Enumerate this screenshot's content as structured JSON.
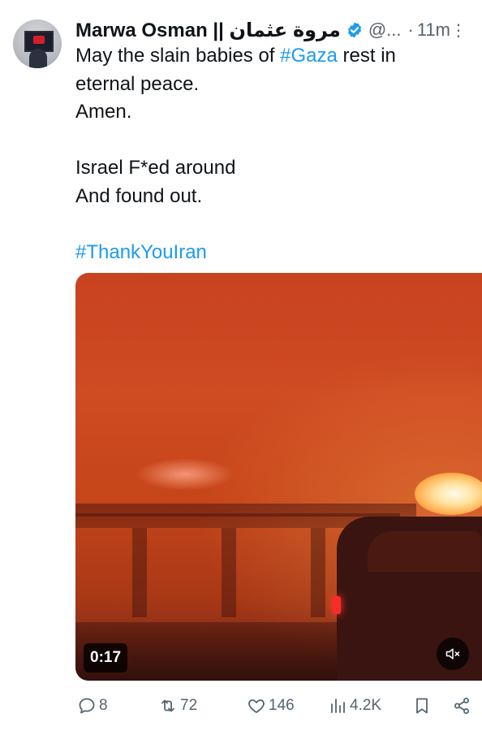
{
  "tweet": {
    "author_name": "Marwa Osman || مروة عثمان",
    "handle": "@...",
    "separator": "·",
    "time": "11m",
    "more_label": "⋮",
    "lines": [
      [
        {
          "t": "May the slain babies of "
        },
        {
          "t": "#Gaza",
          "tag": true
        },
        {
          "t": " rest in"
        }
      ],
      [
        {
          "t": "eternal peace."
        }
      ],
      [
        {
          "t": "Amen."
        }
      ],
      [
        {
          "t": ""
        }
      ],
      [
        {
          "t": "Israel F*ed around"
        }
      ],
      [
        {
          "t": "And found out."
        }
      ],
      [
        {
          "t": ""
        }
      ],
      [
        {
          "t": "#ThankYouIran",
          "tag": true
        }
      ]
    ]
  },
  "media": {
    "duration": "0:17",
    "mute_icon": "speaker-muted-icon"
  },
  "actions": {
    "replies": "8",
    "reposts": "72",
    "likes": "146",
    "views": "4.2K"
  },
  "colors": {
    "hashtag": "#1d9bf0",
    "verified": "#1d9bf0",
    "secondary_text": "#536471"
  }
}
